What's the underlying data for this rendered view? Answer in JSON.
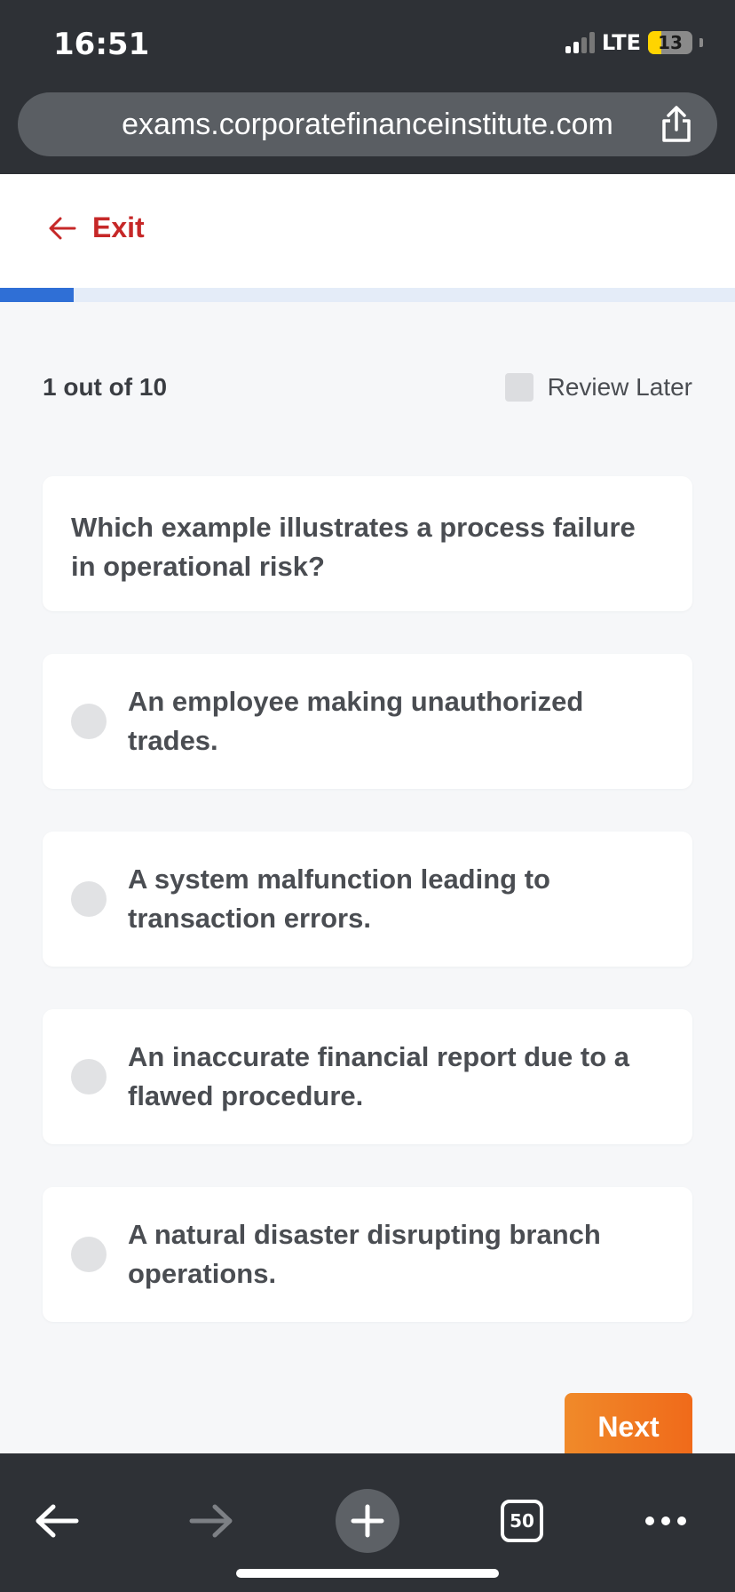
{
  "status_bar": {
    "time": "16:51",
    "network": "LTE",
    "battery": "13"
  },
  "browser": {
    "url": "exams.corporatefinanceinstitute.com",
    "tabs_count": "50"
  },
  "header": {
    "exit_label": "Exit"
  },
  "progress": {
    "fraction": 0.1
  },
  "quiz": {
    "counter": "1 out of 10",
    "review_later_label": "Review Later",
    "question": "Which example illustrates a process failure in operational risk?",
    "options": [
      "An employee making unauthorized trades.",
      "A system malfunction leading to transaction errors.",
      "An inaccurate financial report due to a flawed procedure.",
      "A natural disaster disrupting branch operations."
    ],
    "next_label": "Next"
  },
  "colors": {
    "exit": "#c62828",
    "progress": "#2f6fd6",
    "next_button": "#f07a22"
  }
}
